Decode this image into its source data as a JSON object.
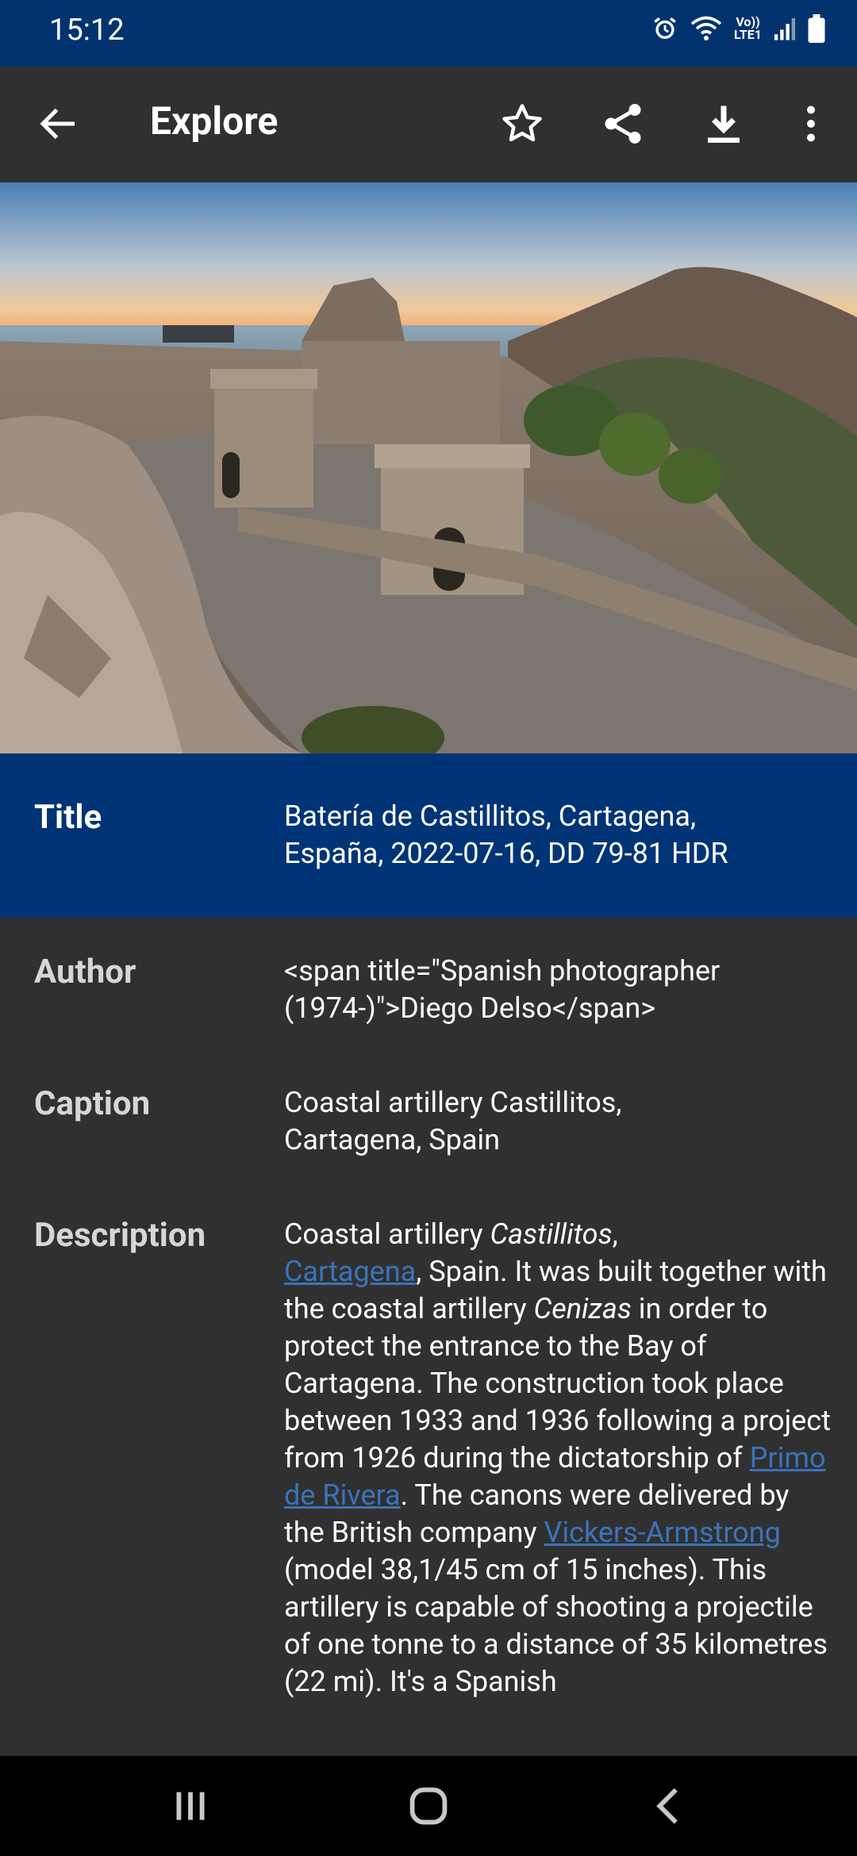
{
  "status": {
    "time": "15:12",
    "network_label_top": "Vo))",
    "network_label_bottom": "LTE1"
  },
  "appbar": {
    "title": "Explore",
    "icons": [
      "back-arrow-icon",
      "star-icon",
      "share-icon",
      "download-icon",
      "more-vert-icon"
    ]
  },
  "details": {
    "title_label": "Title",
    "title_value_line1": "Batería de Castillitos, Cartagena,",
    "title_value_line2": "España, 2022-07-16, DD 79-81 HDR",
    "author_label": "Author",
    "author_value_line1": "<span title=\"Spanish photographer",
    "author_value_line2": "(1974-)\">Diego Delso</span>",
    "caption_label": "Caption",
    "caption_value_line1": "Coastal artillery Castillitos,",
    "caption_value_line2": "Cartagena, Spain",
    "description_label": "Description",
    "description": {
      "p1": "Coastal artillery ",
      "p1_italic": "Castillitos",
      "p1_end": ",",
      "link_cartagena": "Cartagena",
      "p2": ", Spain. It was built together with the coastal artillery ",
      "p2_italic": "Cenizas",
      "p3": " in order to protect the entrance to the Bay of Cartagena. The construction took place between 1933 and 1936 following a project from 1926 during the dictatorship of ",
      "link_primo": "Primo de Rivera",
      "p4": ". The canons were delivered by the British company ",
      "link_vickers": "Vickers-Armstrong",
      "p5": " (model 38,1/45 cm of 15 inches). This artillery is capable of shooting a projectile of one tonne to a distance of 35 kilometres (22 mi). It's a Spanish"
    }
  },
  "colors": {
    "status_bar": "#03336f",
    "title_row": "#003476",
    "background": "#303030",
    "link": "#3b73b9"
  }
}
